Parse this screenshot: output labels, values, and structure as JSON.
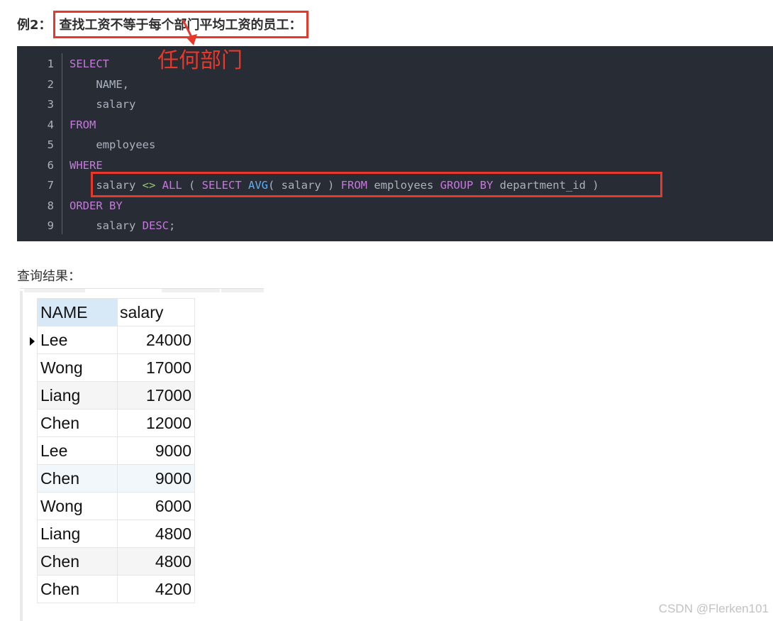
{
  "heading": {
    "prefix": "例2：",
    "title": "查找工资不等于每个部门平均工资的员工："
  },
  "annotation": "任何部门",
  "code": {
    "lines": [
      {
        "n": "1",
        "tokens": [
          {
            "t": "SELECT",
            "c": "kw"
          }
        ]
      },
      {
        "n": "2",
        "tokens": [
          {
            "t": "    NAME,",
            "c": ""
          }
        ]
      },
      {
        "n": "3",
        "tokens": [
          {
            "t": "    salary",
            "c": ""
          }
        ]
      },
      {
        "n": "4",
        "tokens": [
          {
            "t": "FROM",
            "c": "kw"
          }
        ]
      },
      {
        "n": "5",
        "tokens": [
          {
            "t": "    employees",
            "c": ""
          }
        ]
      },
      {
        "n": "6",
        "tokens": [
          {
            "t": "WHERE",
            "c": "kw"
          }
        ]
      },
      {
        "n": "7",
        "tokens": [
          {
            "t": "    salary ",
            "c": ""
          },
          {
            "t": "<>",
            "c": "op"
          },
          {
            "t": " ",
            "c": ""
          },
          {
            "t": "ALL",
            "c": "kw"
          },
          {
            "t": " ( ",
            "c": ""
          },
          {
            "t": "SELECT",
            "c": "kw"
          },
          {
            "t": " ",
            "c": ""
          },
          {
            "t": "AVG",
            "c": "fn"
          },
          {
            "t": "( salary ) ",
            "c": ""
          },
          {
            "t": "FROM",
            "c": "kw"
          },
          {
            "t": " employees ",
            "c": ""
          },
          {
            "t": "GROUP BY",
            "c": "kw"
          },
          {
            "t": " department_id )",
            "c": ""
          }
        ]
      },
      {
        "n": "8",
        "tokens": [
          {
            "t": "ORDER BY",
            "c": "kw"
          }
        ]
      },
      {
        "n": "9",
        "tokens": [
          {
            "t": "    salary ",
            "c": ""
          },
          {
            "t": "DESC",
            "c": "kw"
          },
          {
            "t": ";",
            "c": ""
          }
        ]
      }
    ]
  },
  "result_label": "查询结果：",
  "table": {
    "columns": [
      "NAME",
      "salary"
    ],
    "rows": [
      [
        "Lee",
        "24000"
      ],
      [
        "Wong",
        "17000"
      ],
      [
        "Liang",
        "17000"
      ],
      [
        "Chen",
        "12000"
      ],
      [
        "Lee",
        "9000"
      ],
      [
        "Chen",
        "9000"
      ],
      [
        "Wong",
        "6000"
      ],
      [
        "Liang",
        "4800"
      ],
      [
        "Chen",
        "4800"
      ],
      [
        "Chen",
        "4200"
      ]
    ]
  },
  "watermark": "CSDN @Flerken101",
  "colors": {
    "keyword": "#c678dd",
    "function": "#61afef",
    "operator": "#98c379",
    "highlight_box": "#e8382a",
    "code_bg": "#282c34"
  }
}
